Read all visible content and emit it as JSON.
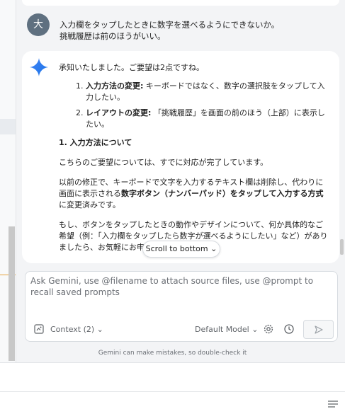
{
  "user_message": {
    "avatar_letter": "大",
    "lines": [
      "入力欄をタップしたときに数字を選べるようにできないか。",
      "挑戦履歴は前のほうがいい。"
    ]
  },
  "response": {
    "intro": "承知いたしました。ご要望は2点ですね。",
    "list": [
      {
        "bold": "入力方法の変更:",
        "text": " キーボードではなく、数字の選択肢をタップして入力したい。"
      },
      {
        "bold": "レイアウトの変更:",
        "text": " 「挑戦履歴」を画面の前のほう（上部）に表示したい。"
      }
    ],
    "section_heading": "1. 入力方法について",
    "p1": "こちらのご要望については、すでに対応が完了しています。",
    "p2_before": "以前の修正で、キーボードで文字を入力するテキスト欄は削除し、代わりに画面に表示される",
    "p2_bold": "数字ボタン（ナンバーパッド）をタップして入力する方式",
    "p2_after": "に変更済みです。",
    "p3": "もし、ボタンをタップしたときの動作やデザインについて、何か具体的なご希望（例：「入力欄をタップしたら数字が選べるようにしたい」など）がありましたら、お気軽にお申し付けください。"
  },
  "scroll_button": {
    "label": "Scroll to bottom"
  },
  "input": {
    "placeholder": "Ask Gemini, use @filename to attach source files, use @prompt to recall saved prompts",
    "context_label": "Context (2)",
    "model_label": "Default Model"
  },
  "disclaimer": "Gemini can make mistakes, so double-check it",
  "colors": {
    "accent_gemini": "#4285f4",
    "avatar_bg": "#5f7080"
  }
}
